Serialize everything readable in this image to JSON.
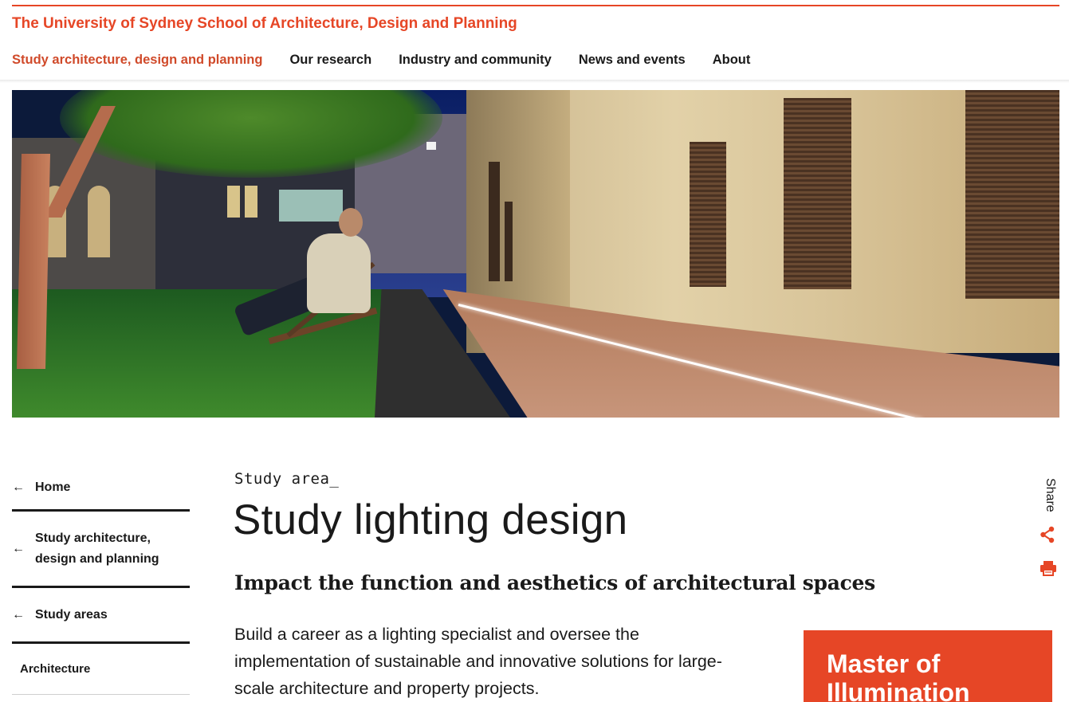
{
  "header": {
    "site_title": "The University of Sydney School of Architecture, Design and Planning",
    "nav": [
      {
        "label": "Study architecture, design and planning",
        "active": true
      },
      {
        "label": "Our research",
        "active": false
      },
      {
        "label": "Industry and community",
        "active": false
      },
      {
        "label": "News and events",
        "active": false
      },
      {
        "label": "About",
        "active": false
      }
    ]
  },
  "sidebar": {
    "items": [
      {
        "label": "Home",
        "icon": "arrow-left-icon"
      },
      {
        "label": "Study architecture, design and planning",
        "icon": "arrow-left-icon"
      },
      {
        "label": "Study areas",
        "icon": "arrow-left-icon"
      },
      {
        "label": "Architecture"
      }
    ]
  },
  "main": {
    "kicker": "Study area_",
    "title": "Study lighting design",
    "subhead": "Impact the function and aesthetics of architectural spaces",
    "intro": "Build a career as a lighting specialist and oversee the implementation of sustainable and innovative solutions for large-scale architecture and property projects."
  },
  "promo": {
    "title": "Master of Illumination"
  },
  "share": {
    "label": "Share",
    "share_icon": "share-icon",
    "print_icon": "print-icon"
  },
  "colors": {
    "brand": "#e64626",
    "text": "#1a1a1a"
  }
}
